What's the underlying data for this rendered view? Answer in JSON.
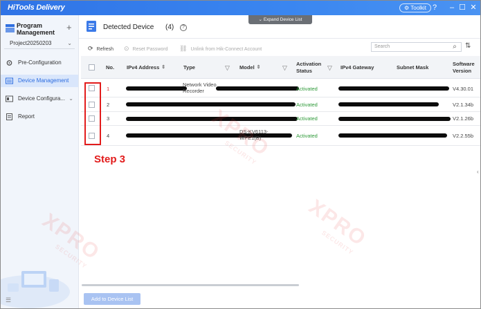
{
  "app": {
    "title": "HiTools Delivery",
    "toolkit_label": "Toolkit"
  },
  "sidebar": {
    "program_title": "Program Management",
    "project": "Project20250203",
    "items": [
      {
        "label": "Pre-Configuration",
        "icon": "gear-icon"
      },
      {
        "label": "Device Management",
        "icon": "device-list-icon",
        "active": true
      },
      {
        "label": "Device Configura...",
        "icon": "device-config-icon"
      },
      {
        "label": "Report",
        "icon": "report-icon"
      }
    ]
  },
  "header": {
    "expand_tab": "Expand Device List",
    "title": "Detected Device",
    "count": "(4)"
  },
  "toolbar": {
    "refresh": "Refresh",
    "reset_password": "Reset Password",
    "unlink": "Unlink from Hik-Connect Account",
    "search_placeholder": "Search"
  },
  "table": {
    "columns": [
      "No.",
      "IPv4 Address",
      "Type",
      "Model",
      "Activation Status",
      "IPv4 Gateway",
      "Subnet Mask",
      "Software Version"
    ],
    "rows": [
      {
        "no": "1",
        "type": "Network Video Recorder",
        "model": "",
        "status": "Activated",
        "version": "V4.30.01"
      },
      {
        "no": "2",
        "type": "",
        "model": "",
        "status": "Activated",
        "version": "V2.1.34b"
      },
      {
        "no": "3",
        "type": "",
        "model": "",
        "status": "Activated",
        "version": "V2.1.26b"
      },
      {
        "no": "4",
        "type": "",
        "model": "DS-KV6113-WPE1(B)",
        "status": "Activated",
        "version": "V2.2.55b"
      }
    ]
  },
  "footer": {
    "add_button": "Add to Device List"
  },
  "annotation": {
    "step_label": "Step 3"
  },
  "watermark": {
    "main": "XPRO",
    "sub": "SECURITY"
  },
  "colors": {
    "accent": "#2f73e6",
    "activated": "#2f9a3a",
    "annotation": "#e21b1b"
  }
}
